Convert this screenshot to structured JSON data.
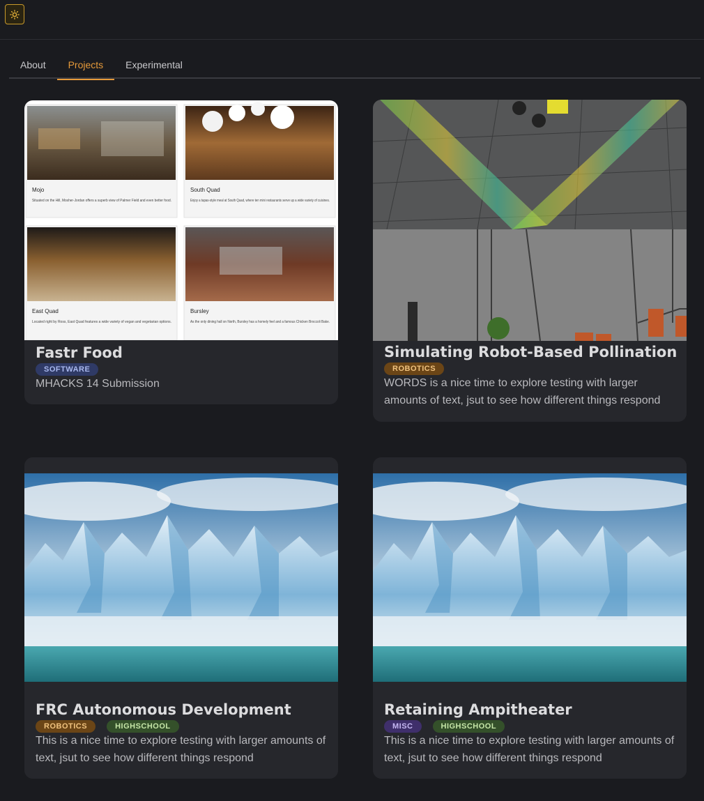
{
  "header": {
    "theme_toggle_icon": "sun-icon"
  },
  "tabs": [
    {
      "label": "About",
      "active": false
    },
    {
      "label": "Projects",
      "active": true
    },
    {
      "label": "Experimental",
      "active": false
    }
  ],
  "projects": [
    {
      "title": "Fastr Food",
      "tags": [
        "SOFTWARE"
      ],
      "description": "MHACKS 14 Submission",
      "image": {
        "kind": "dining-hall-collage",
        "panels": [
          {
            "name": "Mojo",
            "caption": "Situated on the Hill, Mosher-Jordan offers a superb view of Palmer Field and even better food."
          },
          {
            "name": "South Quad",
            "caption": "Enjoy a tapas-style meal at South Quad, where ten mini restaurants serve up a wide variety of cuisines."
          },
          {
            "name": "East Quad",
            "caption": "Located right by Ross, East Quad features a wide variety of vegan and vegetarian options."
          },
          {
            "name": "Bursley",
            "caption": "As the only dining hall on North, Bursley has a homely feel and a famous Chicken Broccoli Bake."
          }
        ]
      }
    },
    {
      "title": "Simulating Robot-Based Pollination",
      "tags": [
        "ROBOTICS"
      ],
      "description": "WORDS is a nice time to explore testing with larger amounts of text, jsut to see how different things respond",
      "image": {
        "kind": "robot-simulation"
      }
    },
    {
      "title": "FRC Autonomous Development",
      "tags": [
        "ROBOTICS",
        "HIGHSCHOOL"
      ],
      "description": "This is a nice time to explore testing with larger amounts of text, jsut to see how different things respond",
      "image": {
        "kind": "glacier"
      }
    },
    {
      "title": "Retaining Ampitheater",
      "tags": [
        "MISC",
        "HIGHSCHOOL"
      ],
      "description": "This is a nice time to explore testing with larger amounts of text, jsut to see how different things respond",
      "image": {
        "kind": "glacier"
      }
    }
  ],
  "colors": {
    "background": "#1a1b1f",
    "card": "#26272c",
    "accent": "#e69a3a"
  }
}
